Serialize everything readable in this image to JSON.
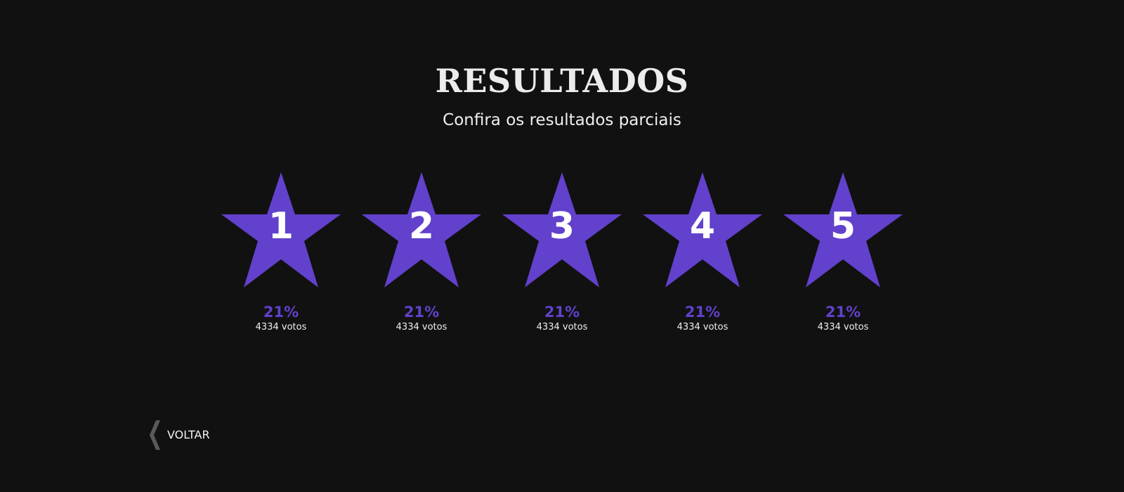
{
  "page": {
    "title": "RESULTADOS",
    "subtitle": "Confira os resultados parciais"
  },
  "results": [
    {
      "label": "1",
      "percent": "21%",
      "votes": "4334 votos"
    },
    {
      "label": "2",
      "percent": "21%",
      "votes": "4334 votos"
    },
    {
      "label": "3",
      "percent": "21%",
      "votes": "4334 votos"
    },
    {
      "label": "4",
      "percent": "21%",
      "votes": "4334 votos"
    },
    {
      "label": "5",
      "percent": "21%",
      "votes": "4334 votos"
    }
  ],
  "navigation": {
    "back_label": "VOLTAR",
    "back_icon": "chevron-left-icon"
  },
  "colors": {
    "background": "#111111",
    "accent": "#6241cc",
    "text": "#ffffff",
    "back_icon": "#5a5a5a"
  }
}
